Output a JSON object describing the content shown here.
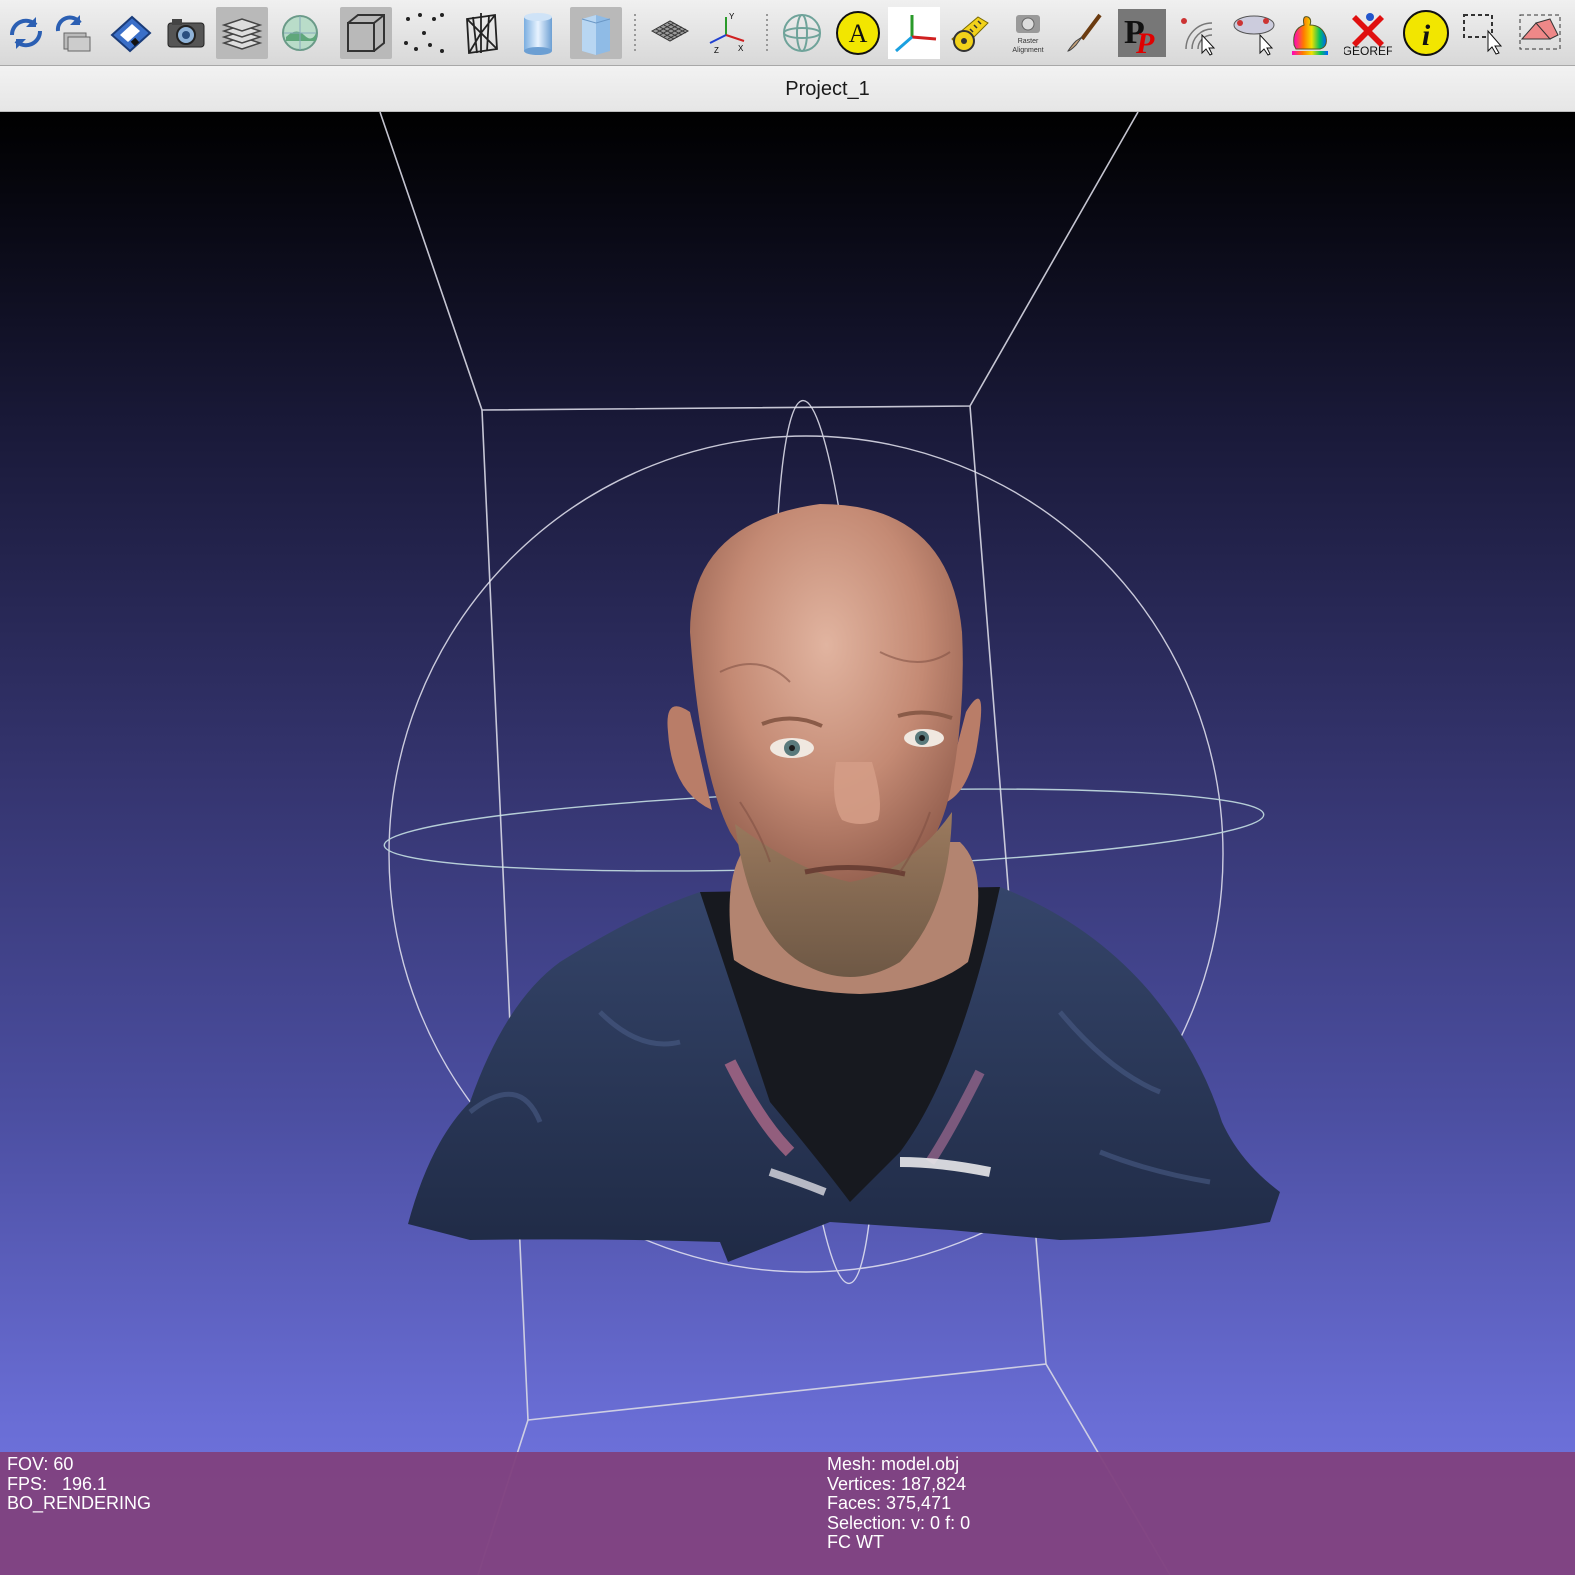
{
  "toolbar": {
    "buttons": [
      {
        "name": "reload-icon"
      },
      {
        "name": "reload-all-icon"
      },
      {
        "name": "save-icon"
      },
      {
        "name": "snapshot-icon"
      },
      {
        "name": "layers-icon",
        "active": true
      },
      {
        "name": "raster-layer-icon"
      },
      {
        "name": "bounding-box-icon",
        "active": true
      },
      {
        "name": "points-icon"
      },
      {
        "name": "wireframe-icon"
      },
      {
        "name": "smooth-shading-icon"
      },
      {
        "name": "flat-shading-icon",
        "active": true
      },
      {
        "name": "grid-icon"
      },
      {
        "name": "axes-icon"
      },
      {
        "name": "trackball-icon"
      },
      {
        "name": "annotation-icon"
      },
      {
        "name": "align-axes-icon"
      },
      {
        "name": "measure-tool-icon"
      },
      {
        "name": "raster-alignment-icon",
        "label": "Raster Alignment"
      },
      {
        "name": "paint-brush-icon"
      },
      {
        "name": "pickpoints-icon"
      },
      {
        "name": "select-vertices-icon"
      },
      {
        "name": "select-faces-icon"
      },
      {
        "name": "quality-mapper-icon"
      },
      {
        "name": "georef-icon",
        "label": "GEOREF"
      },
      {
        "name": "info-icon"
      },
      {
        "name": "select-rect-icon"
      },
      {
        "name": "select-faces-rect-icon"
      }
    ]
  },
  "window": {
    "title": "Project_1"
  },
  "info_left": {
    "fov": "FOV: 60",
    "fps": "FPS:   196.1",
    "mode": "BO_RENDERING"
  },
  "info_right": {
    "mesh": "Mesh: model.obj",
    "vertices": "Vertices: 187,824",
    "faces": "Faces: 375,471",
    "selection": "Selection: v: 0 f: 0",
    "flags": "FC WT"
  },
  "colors": {
    "info_panel": "#7f427f",
    "viewport_top": "#000000",
    "viewport_bottom": "#7478e4",
    "jacket": "#2f3d62",
    "skin": "#c9927e"
  }
}
